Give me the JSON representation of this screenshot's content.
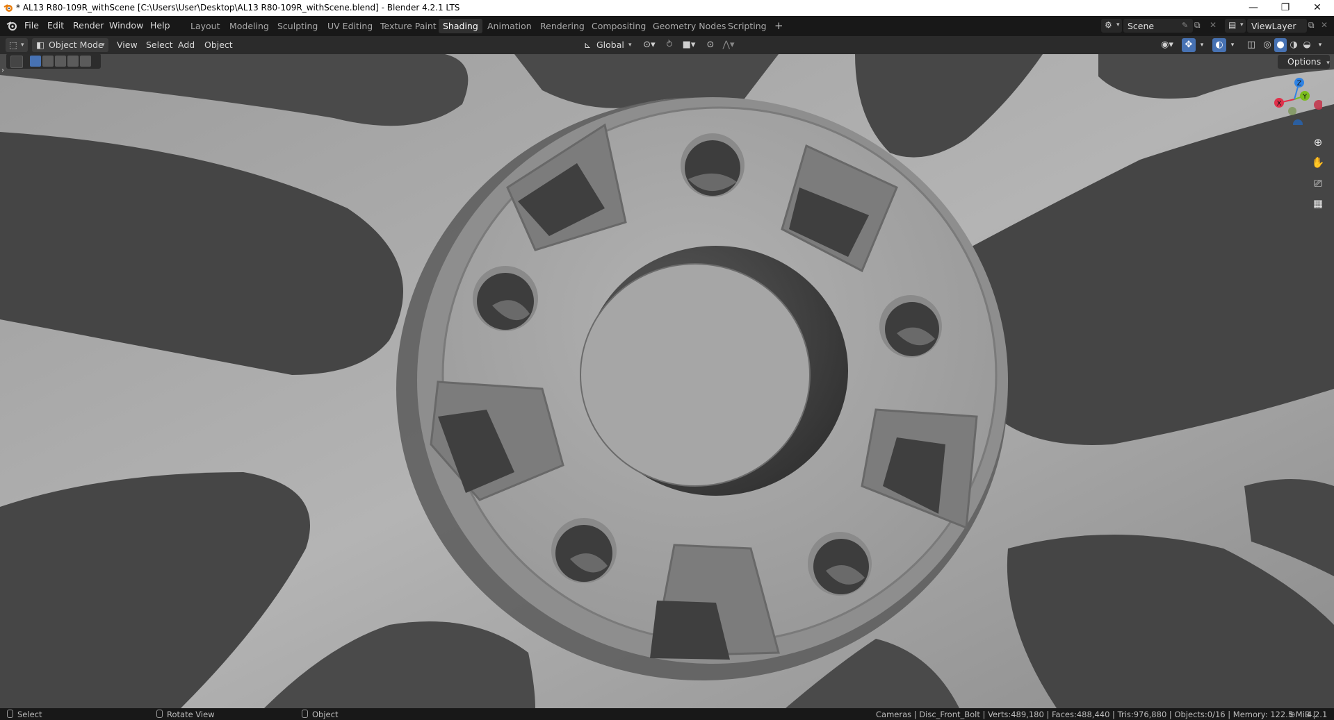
{
  "window": {
    "title": "* AL13 R80-109R_withScene [C:\\Users\\User\\Desktop\\AL13 R80-109R_withScene.blend] - Blender 4.2.1 LTS",
    "controls": [
      "—",
      "❐",
      "✕"
    ]
  },
  "menubar": {
    "items": [
      "File",
      "Edit",
      "Render",
      "Window",
      "Help"
    ]
  },
  "workspaces": {
    "tabs": [
      "Layout",
      "Modeling",
      "Sculpting",
      "UV Editing",
      "Texture Paint",
      "Shading",
      "Animation",
      "Rendering",
      "Compositing",
      "Geometry Nodes",
      "Scripting"
    ],
    "active": "Shading",
    "add": "+"
  },
  "scene": {
    "name": "Scene"
  },
  "view_layer": {
    "name": "ViewLayer"
  },
  "viewport_header": {
    "mode": "Object Mode",
    "menus": [
      "View",
      "Select",
      "Add",
      "Object"
    ],
    "orientation": "Global",
    "options_label": "Options"
  },
  "gizmo": {
    "x": "X",
    "y": "Y",
    "z": "Z"
  },
  "statusbar": {
    "left": [
      "Select",
      "Rotate View",
      "Object"
    ],
    "stats": "Cameras | Disc_Front_Bolt | Verts:489,180 | Faces:488,440 | Tris:976,880 | Objects:0/16 | Memory: 122.5 MiB |",
    "version": "4.2.1"
  },
  "colors": {
    "accent": "#4772b3",
    "active_tab": "#303030",
    "axis_x": "#e0304a",
    "axis_y": "#7bbd1e",
    "axis_z": "#2f83e4",
    "model_gray": "#a3a3a3",
    "model_shadow": "#474747"
  }
}
